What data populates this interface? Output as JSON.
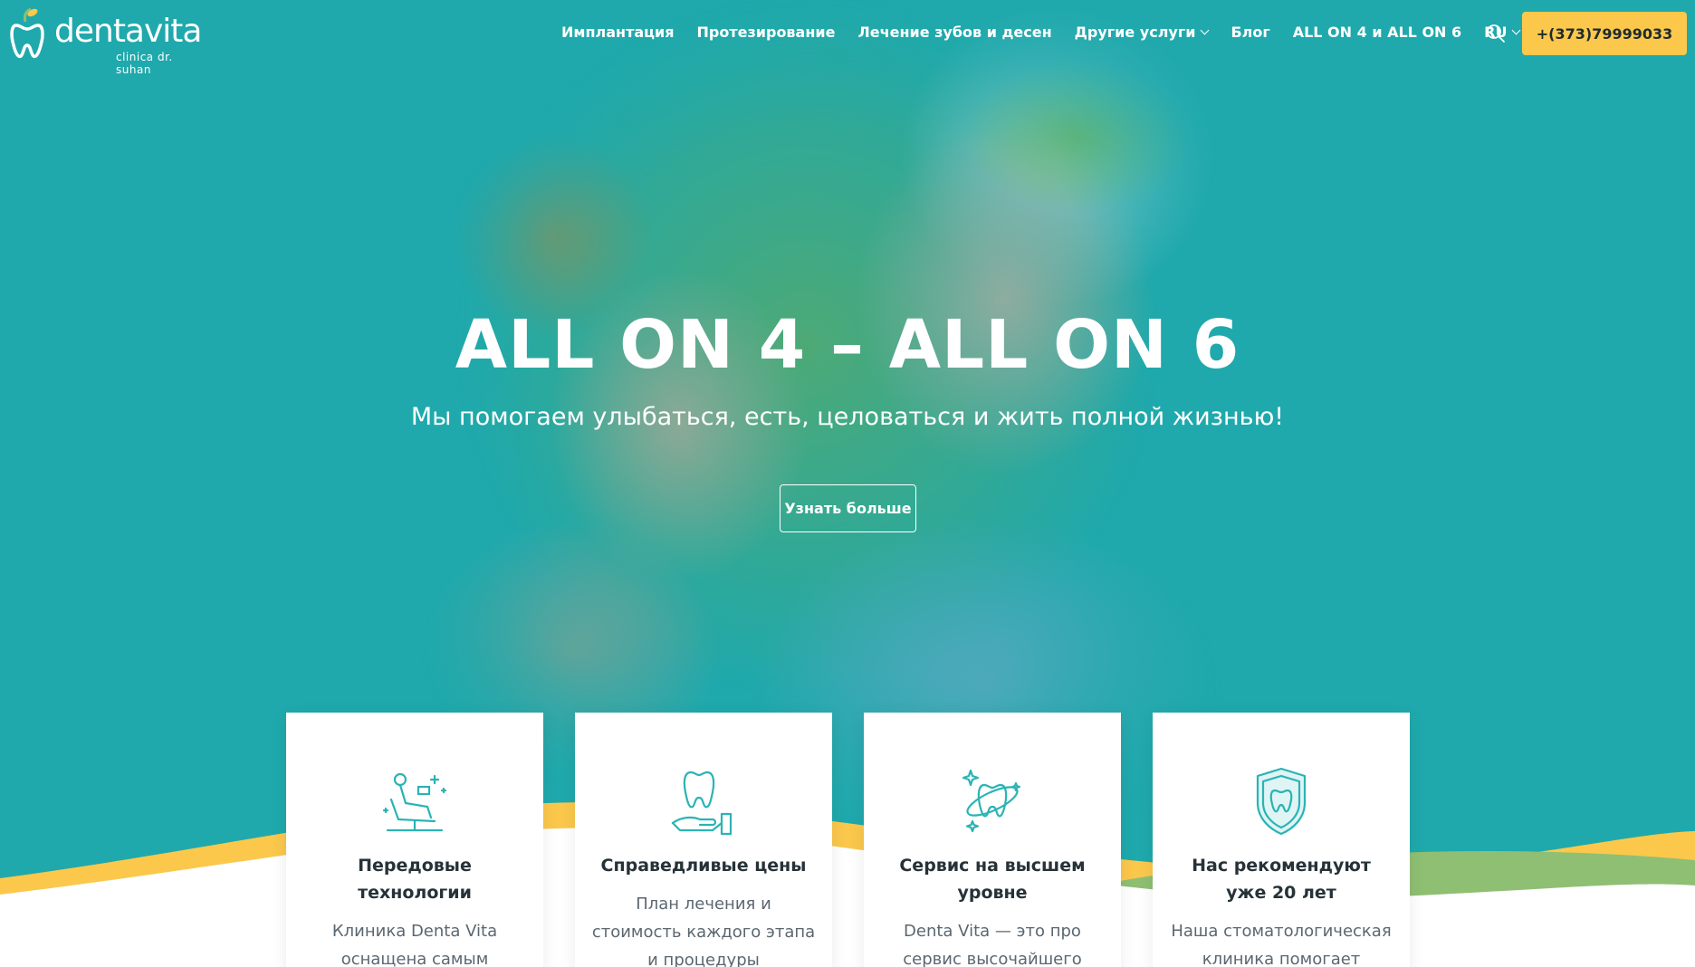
{
  "header": {
    "logo_text": "dentavita",
    "logo_sub": "clinica dr. suhan",
    "nav": [
      {
        "label": "Имплантация",
        "dropdown": false
      },
      {
        "label": "Протезирование",
        "dropdown": false
      },
      {
        "label": "Лечение зубов и десен",
        "dropdown": false
      },
      {
        "label": "Другие услуги",
        "dropdown": true
      },
      {
        "label": "Блог",
        "dropdown": false
      },
      {
        "label": "ALL ON 4 и ALL ON 6",
        "dropdown": false
      },
      {
        "label": "RU",
        "dropdown": true
      }
    ],
    "search_icon": "search-icon",
    "phone": "+(373)79999033"
  },
  "hero": {
    "title": "ALL ON 4 – ALL ON 6",
    "subtitle": "Мы помогаем улыбаться, есть, целоваться и жить полной жизнью!",
    "button": "Узнать больше"
  },
  "features": [
    {
      "icon": "dental-chair-icon",
      "title": "Передовые технологии",
      "text": "Клиника Denta Vita оснащена самым"
    },
    {
      "icon": "tooth-hand-icon",
      "title": "Справедливые цены",
      "text": "План лечения и стоимость каждого этапа и процедуры"
    },
    {
      "icon": "sparkling-tooth-icon",
      "title": "Сервис на высшем уровне",
      "text": "Denta Vita — это про сервис высочайшего"
    },
    {
      "icon": "tooth-shield-icon",
      "title": "Нас рекомендуют уже 20 лет",
      "text": "Наша стоматологическая клиника помогает"
    }
  ],
  "colors": {
    "teal": "#1fa9ad",
    "yellow": "#fbc84c",
    "green": "#8fbf73",
    "icon_teal": "#2bb3b4"
  }
}
